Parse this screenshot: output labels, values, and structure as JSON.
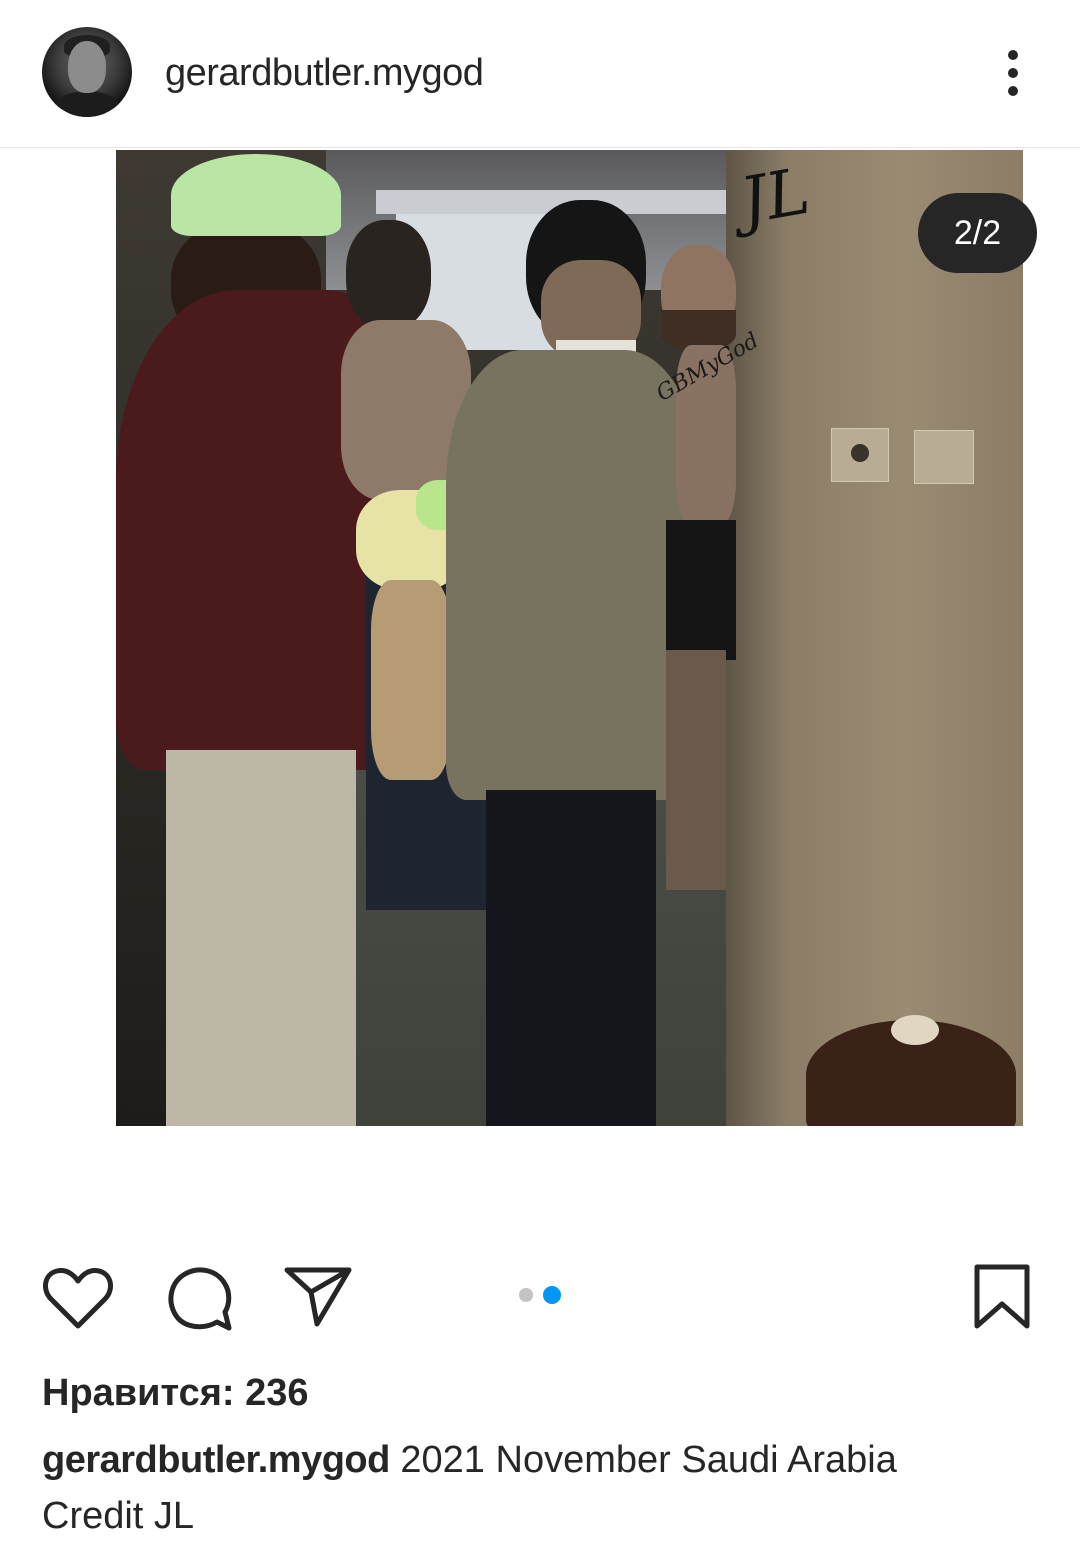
{
  "post": {
    "username": "gerardbutler.mygod",
    "counter": "2/2",
    "watermark": "JL",
    "watermark_small": "GBMyGod",
    "likes": "Нравится: 236",
    "caption_user": "gerardbutler.mygod",
    "caption_text": "2021 November Saudi Arabia",
    "caption_line2": "Credit JL"
  },
  "carousel": {
    "total": 2,
    "active": 2
  },
  "colors": {
    "text": "#262626",
    "dot_active": "#0095f6",
    "dot_inactive": "#c4c4c4",
    "counter_bg": "#262626"
  },
  "icons": [
    "more-vertical-icon",
    "heart-icon",
    "comment-icon",
    "share-icon",
    "bookmark-icon"
  ]
}
